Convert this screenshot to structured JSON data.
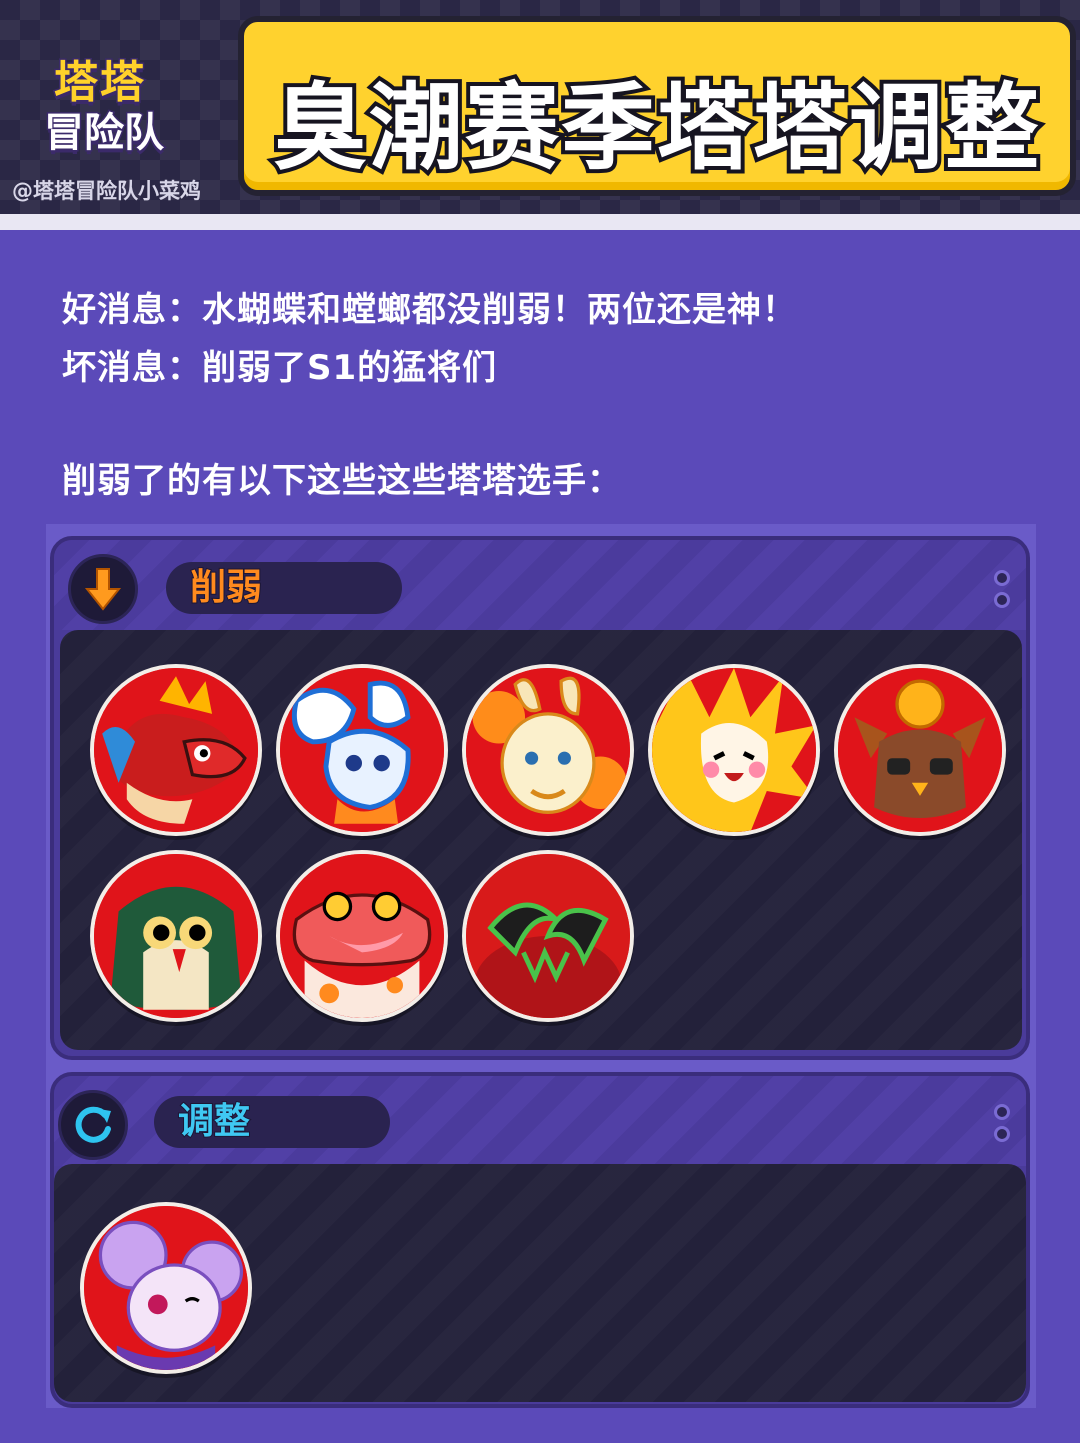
{
  "header": {
    "logo_line1": "塔塔",
    "logo_line2": "冒险队",
    "watermark": "@塔塔冒险队小菜鸡",
    "title": "臭潮赛季塔塔调整"
  },
  "intro": {
    "good_news": "好消息：水蝴蝶和螳螂都没削弱！两位还是神！",
    "bad_news": "坏消息：削弱了S1的猛将们",
    "list_heading": "削弱了的有以下这些这些塔塔选手："
  },
  "nerf_panel": {
    "label": "削弱",
    "icon": "down-arrow-icon",
    "accent": "#ff8a1e",
    "characters": [
      {
        "icon": "red-dragon-portrait"
      },
      {
        "icon": "blue-butterfly-portrait"
      },
      {
        "icon": "cream-bunny-portrait"
      },
      {
        "icon": "sunflower-girl-portrait"
      },
      {
        "icon": "owl-totem-portrait"
      },
      {
        "icon": "green-owl-portrait"
      },
      {
        "icon": "pink-frog-portrait"
      },
      {
        "icon": "carnivorous-plant-portrait"
      }
    ]
  },
  "adjust_panel": {
    "label": "调整",
    "icon": "refresh-icon",
    "accent": "#2ec4f0",
    "characters": [
      {
        "icon": "purple-mouse-portrait"
      }
    ]
  }
}
